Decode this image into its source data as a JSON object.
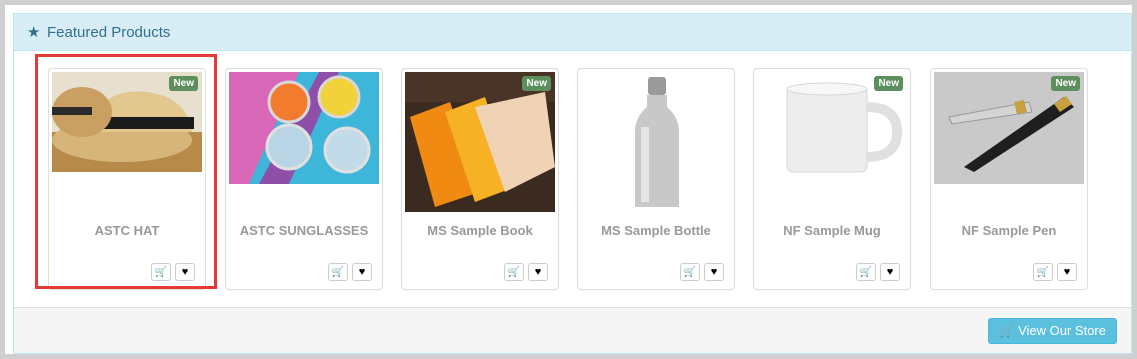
{
  "panel": {
    "title": "Featured Products",
    "star_icon": "star-icon"
  },
  "products": [
    {
      "name": "ASTC HAT",
      "badge": "New"
    },
    {
      "name": "ASTC SUNGLASSES",
      "badge": ""
    },
    {
      "name": "MS Sample Book",
      "badge": "New"
    },
    {
      "name": "MS Sample Bottle",
      "badge": ""
    },
    {
      "name": "NF Sample Mug",
      "badge": "New"
    },
    {
      "name": "NF Sample Pen",
      "badge": "New"
    }
  ],
  "footer": {
    "store_button_label": "View Our Store"
  },
  "colors": {
    "heading_bg": "#d9edf7",
    "heading_text": "#31708f",
    "badge": "#5d8f5d",
    "store_button": "#5bc0de",
    "highlight": "#e53935"
  }
}
